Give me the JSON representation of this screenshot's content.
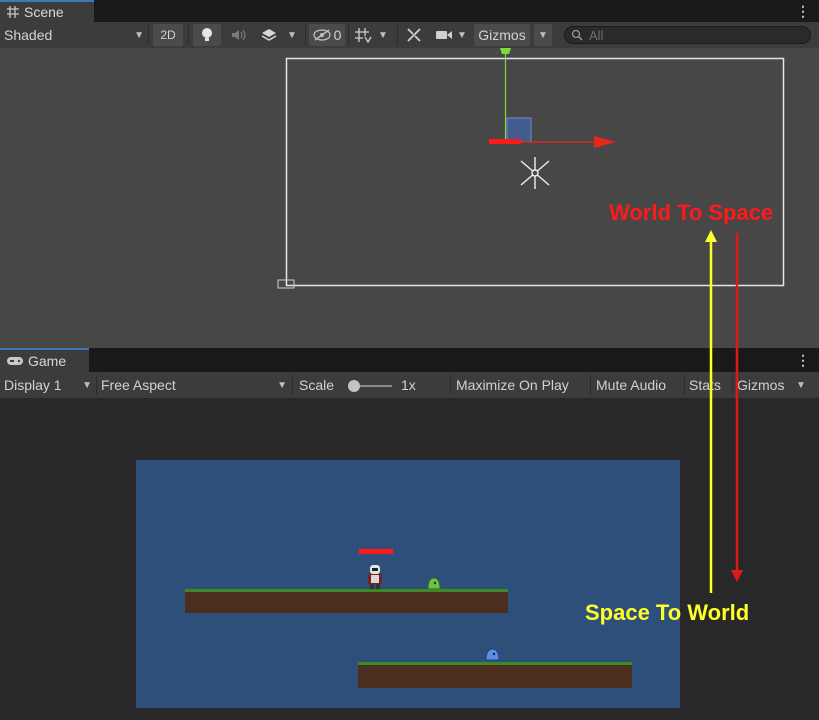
{
  "scene": {
    "tab_label": "Scene",
    "shading_mode": "Shaded",
    "mode_2d_label": "2D",
    "hidden_count": "0",
    "gizmos_label": "Gizmos",
    "search_placeholder": "All"
  },
  "game": {
    "tab_label": "Game",
    "display_label": "Display 1",
    "aspect_label": "Free Aspect",
    "scale_label": "Scale",
    "scale_value": "1x",
    "maximize_label": "Maximize On Play",
    "mute_label": "Mute Audio",
    "stats_label": "Stats",
    "gizmos_label": "Gizmos"
  },
  "annotations": {
    "world_to_space": "World To Space",
    "space_to_world": "Space To World"
  },
  "colors": {
    "world_to_space": "#ff1a1a",
    "space_to_world": "#ffff2a",
    "x_axis": "#e8261b",
    "y_axis": "#7ddc3a",
    "game_background": "#2f4f7b"
  },
  "icons": [
    "grid-icon",
    "lightbulb-icon",
    "audio-icon",
    "layers-icon",
    "visibility-icon",
    "grid-snap-icon",
    "tools-icon",
    "camera-icon",
    "search-icon",
    "gamepad-icon",
    "kebab-menu-icon"
  ]
}
